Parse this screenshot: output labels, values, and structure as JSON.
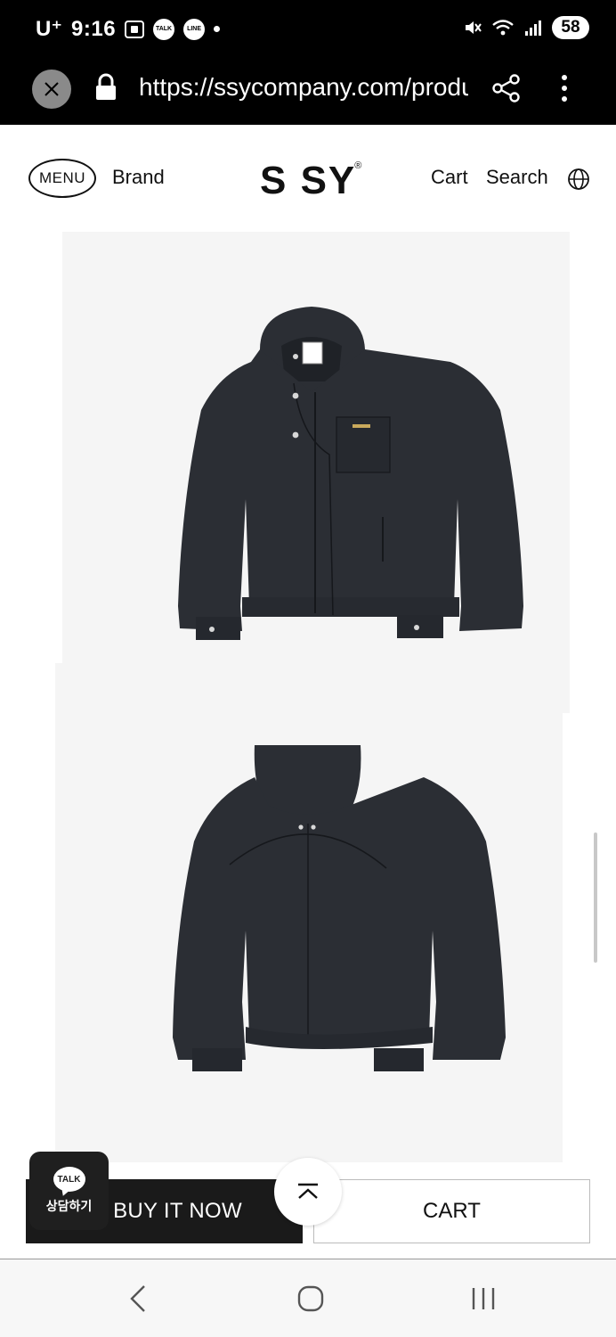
{
  "status_bar": {
    "carrier": "U⁺",
    "time": "9:16",
    "notif_talk": "TALK",
    "notif_line": "LINE",
    "battery": "58"
  },
  "browser": {
    "url": "https://ssycompany.com/product"
  },
  "header": {
    "menu_label": "MENU",
    "brand_label": "Brand",
    "logo_text": "S SY",
    "logo_mark": "®",
    "cart_label": "Cart",
    "search_label": "Search"
  },
  "product": {
    "jacket_color": "#2b2e34",
    "image_background": "#f5f5f5"
  },
  "actions": {
    "buy_now_label": "BUY IT NOW",
    "cart_label": "CART"
  },
  "chat": {
    "bubble_label": "TALK",
    "label": "상담하기"
  }
}
